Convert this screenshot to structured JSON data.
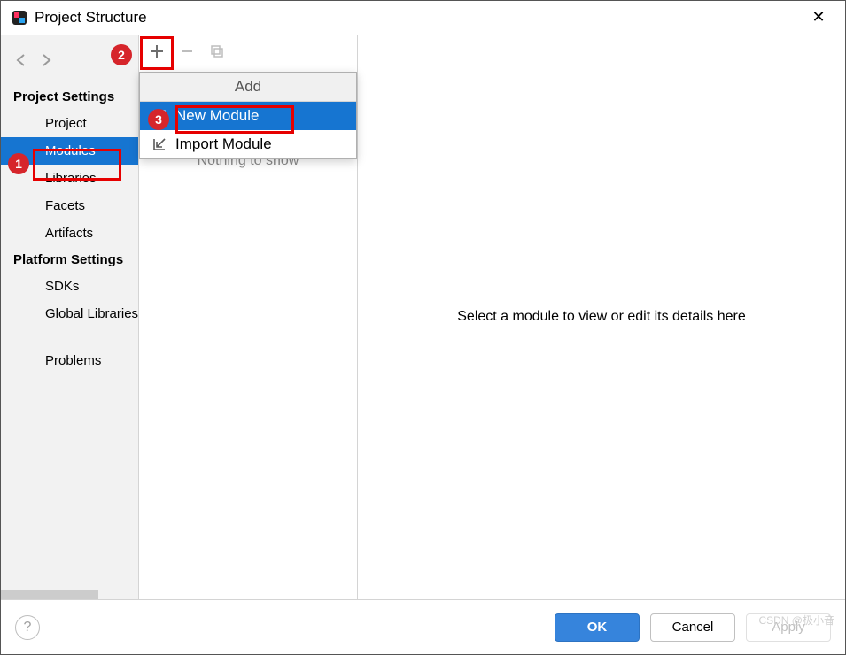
{
  "window": {
    "title": "Project Structure"
  },
  "sidebar": {
    "sections": {
      "project_settings": "Project Settings",
      "platform_settings": "Platform Settings"
    },
    "items": {
      "project": "Project",
      "modules": "Modules",
      "libraries": "Libraries",
      "facets": "Facets",
      "artifacts": "Artifacts",
      "sdks": "SDKs",
      "global_libraries": "Global Libraries",
      "problems": "Problems"
    }
  },
  "mid": {
    "placeholder": "Nothing to show"
  },
  "popup": {
    "header": "Add",
    "new_module": "New Module",
    "import_module": "Import Module"
  },
  "details": {
    "placeholder": "Select a module to view or edit its details here"
  },
  "footer": {
    "ok": "OK",
    "cancel": "Cancel",
    "apply": "Apply"
  },
  "annotations": {
    "a1": "1",
    "a2": "2",
    "a3": "3"
  },
  "watermark": "CSDN @极小音"
}
